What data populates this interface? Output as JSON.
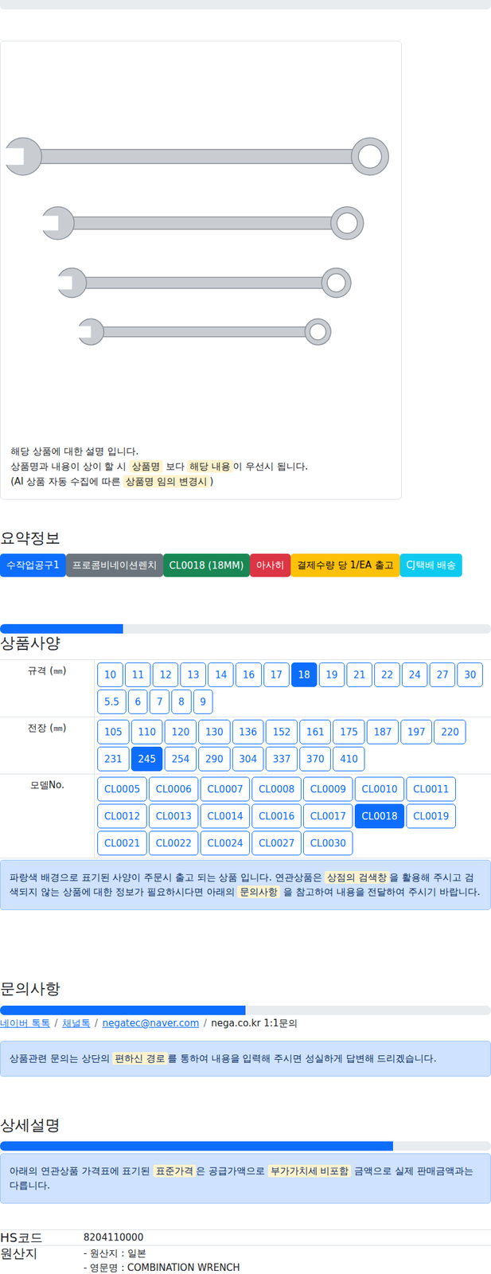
{
  "product": {
    "description": [
      [
        {
          "text": "해당 상품에 대한 설명 입니다.",
          "highlight": false
        }
      ],
      [
        {
          "text": "상품명과 내용이 상이 할 시 ",
          "highlight": false
        },
        {
          "text": "상품명",
          "highlight": true
        },
        {
          "text": " 보다 ",
          "highlight": false
        },
        {
          "text": "해당 내용",
          "highlight": true
        },
        {
          "text": "이 우선시 됩니다.",
          "highlight": false
        }
      ],
      [
        {
          "text": "(AI 상품 자동 수집에 따른 ",
          "highlight": false
        },
        {
          "text": "상품명 임의 변경시",
          "highlight": true
        },
        {
          "text": ")",
          "highlight": false
        }
      ]
    ]
  },
  "summary": {
    "title": "요약정보",
    "badges": [
      {
        "label": "수작업공구1",
        "color": "#0d6efd"
      },
      {
        "label": "프로콤비네이션렌치",
        "color": "#6c757d"
      },
      {
        "label": "CL0018 (18MM)",
        "color": "#198754"
      },
      {
        "label": "아사히",
        "color": "#dc3545"
      },
      {
        "label": "결제수량 당 1/EA 출고",
        "color": "#ffc107"
      },
      {
        "label": "CJ택배 배송",
        "color": "#0dcaf0"
      }
    ]
  },
  "spec": {
    "title": "상품사양",
    "level": 0.25,
    "rows": [
      {
        "label": "규격 (㎜)",
        "options": [
          {
            "label": "10",
            "selected": false
          },
          {
            "label": "11",
            "selected": false
          },
          {
            "label": "12",
            "selected": false
          },
          {
            "label": "13",
            "selected": false
          },
          {
            "label": "14",
            "selected": false
          },
          {
            "label": "16",
            "selected": false
          },
          {
            "label": "17",
            "selected": false
          },
          {
            "label": "18",
            "selected": true
          },
          {
            "label": "19",
            "selected": false
          },
          {
            "label": "21",
            "selected": false
          },
          {
            "label": "22",
            "selected": false
          },
          {
            "label": "24",
            "selected": false
          },
          {
            "label": "27",
            "selected": false
          },
          {
            "label": "30",
            "selected": false
          },
          {
            "label": "5.5",
            "selected": false
          },
          {
            "label": "6",
            "selected": false
          },
          {
            "label": "7",
            "selected": false
          },
          {
            "label": "8",
            "selected": false
          },
          {
            "label": "9",
            "selected": false
          }
        ]
      },
      {
        "label": "전장 (㎜)",
        "options": [
          {
            "label": "105",
            "selected": false
          },
          {
            "label": "110",
            "selected": false
          },
          {
            "label": "120",
            "selected": false
          },
          {
            "label": "130",
            "selected": false
          },
          {
            "label": "136",
            "selected": false
          },
          {
            "label": "152",
            "selected": false
          },
          {
            "label": "161",
            "selected": false
          },
          {
            "label": "175",
            "selected": false
          },
          {
            "label": "187",
            "selected": false
          },
          {
            "label": "197",
            "selected": false
          },
          {
            "label": "220",
            "selected": false
          },
          {
            "label": "231",
            "selected": false
          },
          {
            "label": "245",
            "selected": true
          },
          {
            "label": "254",
            "selected": false
          },
          {
            "label": "290",
            "selected": false
          },
          {
            "label": "304",
            "selected": false
          },
          {
            "label": "337",
            "selected": false
          },
          {
            "label": "370",
            "selected": false
          },
          {
            "label": "410",
            "selected": false
          }
        ]
      },
      {
        "label": "모델No.",
        "options": [
          {
            "label": "CL0005",
            "selected": false
          },
          {
            "label": "CL0006",
            "selected": false
          },
          {
            "label": "CL0007",
            "selected": false
          },
          {
            "label": "CL0008",
            "selected": false
          },
          {
            "label": "CL0009",
            "selected": false
          },
          {
            "label": "CL0010",
            "selected": false
          },
          {
            "label": "CL0011",
            "selected": false
          },
          {
            "label": "CL0012",
            "selected": false
          },
          {
            "label": "CL0013",
            "selected": false
          },
          {
            "label": "CL0014",
            "selected": false
          },
          {
            "label": "CL0016",
            "selected": false
          },
          {
            "label": "CL0017",
            "selected": false
          },
          {
            "label": "CL0018",
            "selected": true
          },
          {
            "label": "CL0019",
            "selected": false
          },
          {
            "label": "CL0021",
            "selected": false
          },
          {
            "label": "CL0022",
            "selected": false
          },
          {
            "label": "CL0024",
            "selected": false
          },
          {
            "label": "CL0027",
            "selected": false
          },
          {
            "label": "CL0030",
            "selected": false
          }
        ]
      }
    ],
    "notice": [
      {
        "text": "파랑색 배경으로 표기된 사양이 주문시 출고 되는 상품 입니다. 연관상품은 ",
        "highlight": false
      },
      {
        "text": "상점의 검색창",
        "highlight": true
      },
      {
        "text": "을 활용해 주시고 검색되지 않는 상품에 대한 정보가 필요하시다면 아래의 ",
        "highlight": false
      },
      {
        "text": "문의사항",
        "highlight": true
      },
      {
        "text": " 을 참고하여 내용을 전달하여 주시기 바랍니다.",
        "highlight": false
      }
    ]
  },
  "inquiry": {
    "title": "문의사항",
    "level": 0.5,
    "separator": "/",
    "links": [
      {
        "label": "네이버 톡톡",
        "link": true
      },
      {
        "label": "채널톡",
        "link": true
      },
      {
        "label": "negatec@naver.com",
        "link": true
      },
      {
        "label": "nega.co.kr 1:1문의",
        "link": false
      }
    ],
    "notice": [
      {
        "text": "상품관련 문의는 상단의 ",
        "highlight": false
      },
      {
        "text": "편하신 경로",
        "highlight": true
      },
      {
        "text": "를 통하여 내용을 입력해 주시면 성실하게 답변해 드리겠습니다.",
        "highlight": false
      }
    ]
  },
  "detail": {
    "title": "상세설명",
    "level": 0.8,
    "notice": [
      {
        "text": "아래의 연관상품 가격표에 표기된 ",
        "highlight": false
      },
      {
        "text": "표준가격",
        "highlight": true
      },
      {
        "text": "은 공급가액으로 ",
        "highlight": false
      },
      {
        "text": "부가가치세 비포함",
        "highlight": true
      },
      {
        "text": " 금액으로 실제 판매금액과는 다릅니다.",
        "highlight": false
      }
    ],
    "table": [
      {
        "label": "HS코드",
        "values": [
          "8204110000"
        ]
      },
      {
        "label": "원산지",
        "values": [
          "- 원산지 : 일본",
          "- 영문명 : COMBINATION WRENCH"
        ]
      }
    ]
  }
}
